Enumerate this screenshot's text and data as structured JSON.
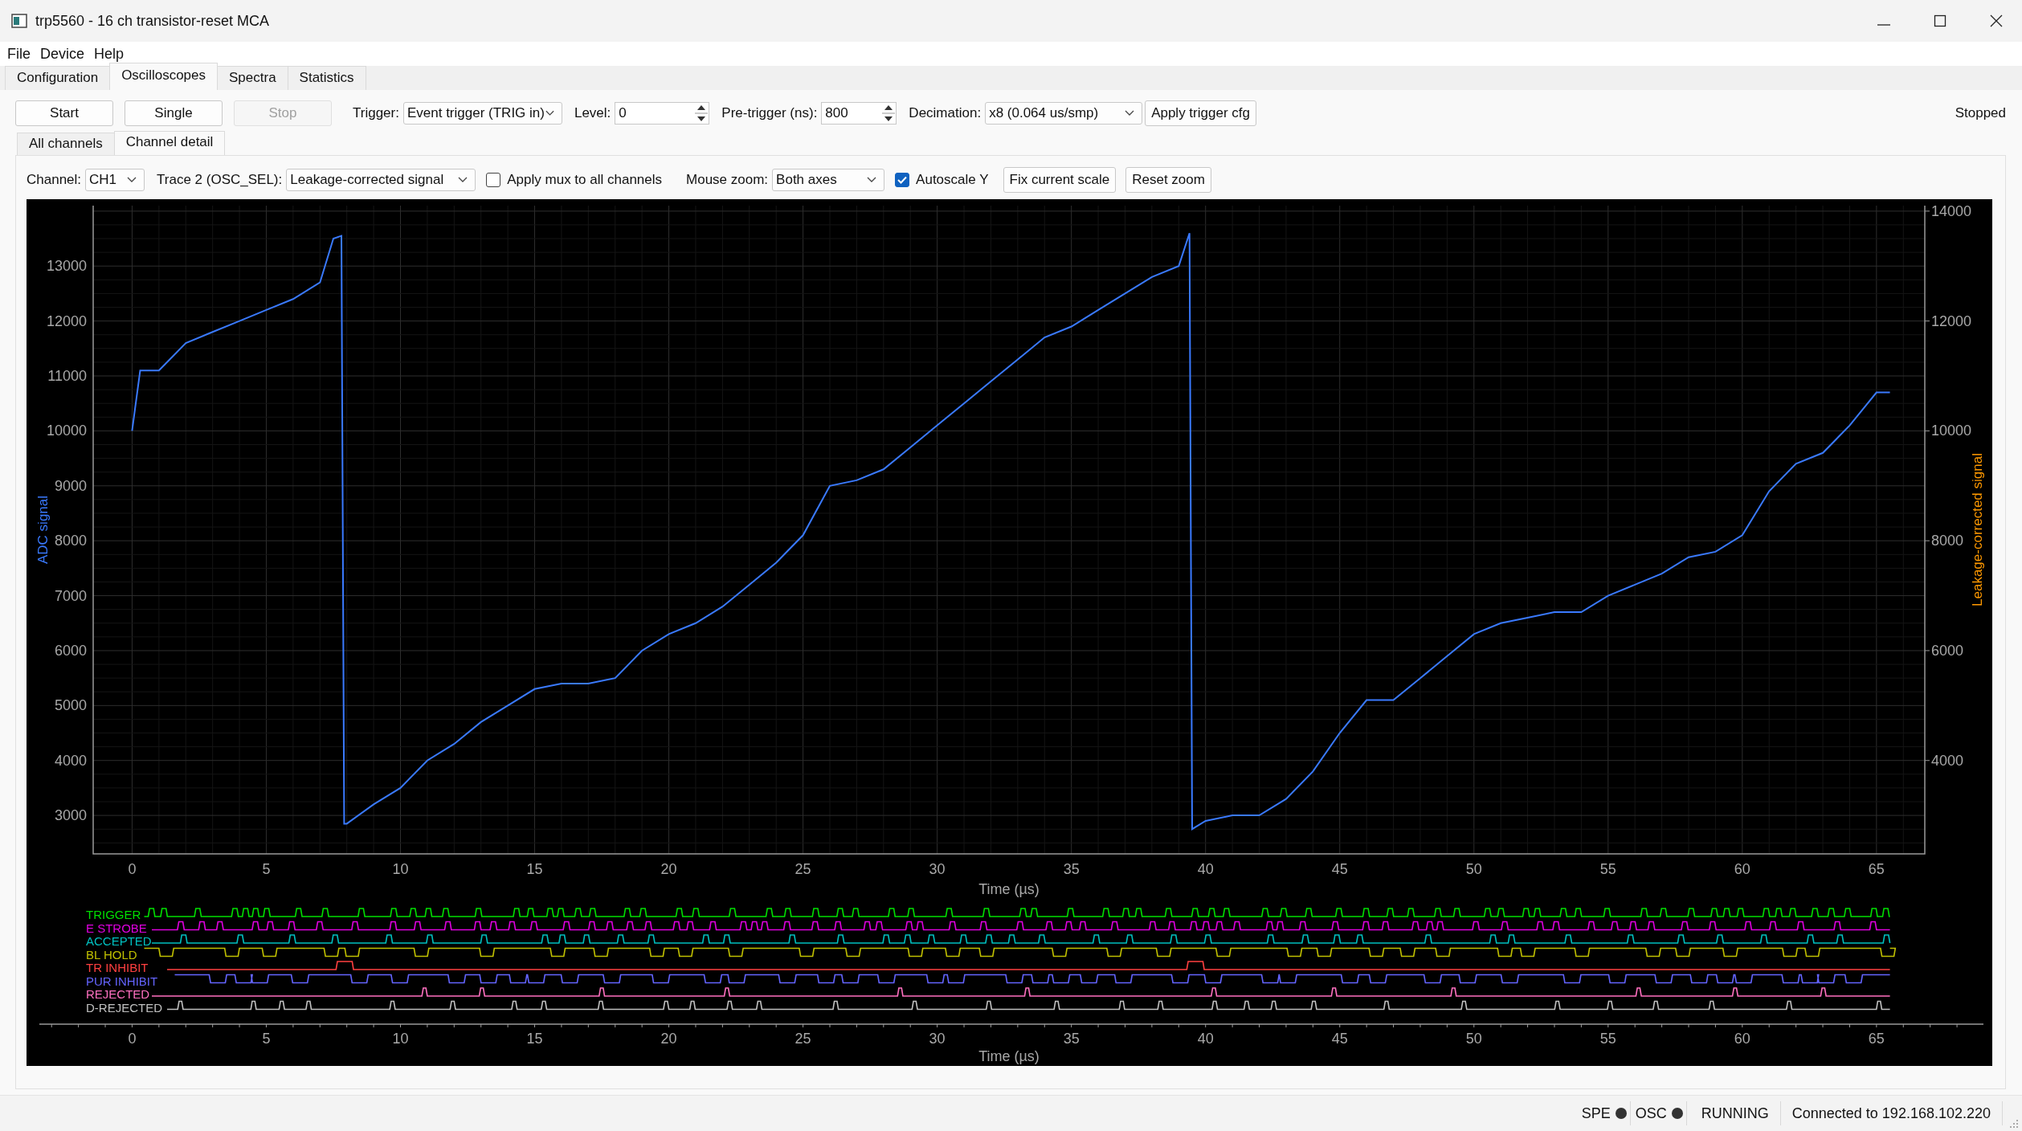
{
  "window": {
    "title": "trp5560 - 16 ch transistor-reset MCA"
  },
  "menu": [
    "File",
    "Device",
    "Help"
  ],
  "tabs": [
    {
      "label": "Configuration",
      "selected": false
    },
    {
      "label": "Oscilloscopes",
      "selected": true
    },
    {
      "label": "Spectra",
      "selected": false
    },
    {
      "label": "Statistics",
      "selected": false
    }
  ],
  "toolbar": {
    "buttons": [
      {
        "label": "Start",
        "disabled": false
      },
      {
        "label": "Single",
        "disabled": false
      },
      {
        "label": "Stop",
        "disabled": true
      }
    ],
    "trigger": {
      "label": "Trigger:",
      "value": "Event trigger (TRIG in)"
    },
    "level": {
      "label": "Level:",
      "value": "0"
    },
    "pretrigger": {
      "label": "Pre-trigger (ns):",
      "value": "800"
    },
    "decimation": {
      "label": "Decimation:",
      "value": "x8 (0.064 us/smp)"
    },
    "apply_button": "Apply trigger cfg",
    "state": "Stopped"
  },
  "subtabs": [
    {
      "label": "All channels",
      "selected": false
    },
    {
      "label": "Channel detail",
      "selected": true
    }
  ],
  "controls": {
    "channel": {
      "label": "Channel:",
      "value": "CH1"
    },
    "trace2": {
      "label": "Trace 2 (OSC_SEL):",
      "value": "Leakage-corrected signal"
    },
    "mux": {
      "label": "Apply mux to all channels",
      "checked": false
    },
    "mouse_zoom": {
      "label": "Mouse zoom:",
      "value": "Both axes"
    },
    "autoscale": {
      "label": "Autoscale Y",
      "checked": true
    },
    "buttons": [
      "Fix current scale",
      "Reset zoom"
    ]
  },
  "plot": {
    "chart_data": {
      "type": "line",
      "grid": true,
      "xlabel": "Time (µs)",
      "x": [
        0,
        0.3,
        1,
        2,
        3,
        4,
        5,
        6,
        7,
        7.5,
        7.8,
        7.9,
        8,
        9,
        10,
        11,
        12,
        13,
        14,
        15,
        16,
        17,
        18,
        19,
        20,
        21,
        22,
        23,
        24,
        25,
        26,
        27,
        28,
        29,
        30,
        31,
        32,
        33,
        34,
        35,
        36,
        37,
        38,
        39,
        39.4,
        39.5,
        40,
        41,
        42,
        43,
        44,
        45,
        46,
        47,
        48,
        49,
        50,
        51,
        52,
        53,
        54,
        55,
        56,
        57,
        58,
        59,
        60,
        61,
        62,
        63,
        64,
        65,
        65.5
      ],
      "series": [
        {
          "name": "ADC signal",
          "color": "#3a7aff",
          "values": [
            10000,
            11100,
            11100,
            11600,
            11800,
            12000,
            12200,
            12400,
            12700,
            13500,
            13550,
            2850,
            2850,
            3200,
            3500,
            4000,
            4300,
            4700,
            5000,
            5300,
            5400,
            5400,
            5500,
            6000,
            6300,
            6500,
            6800,
            7200,
            7600,
            8100,
            9000,
            9100,
            9300,
            9700,
            10100,
            10500,
            10900,
            11300,
            11700,
            11900,
            12200,
            12500,
            12800,
            13000,
            13600,
            2750,
            2900,
            3000,
            3000,
            3300,
            3800,
            4500,
            5100,
            5100,
            5500,
            5900,
            6300,
            6500,
            6600,
            6700,
            6700,
            7000,
            7200,
            7400,
            7700,
            7800,
            8100,
            8900,
            9400,
            9600,
            10100,
            10700,
            10700
          ]
        }
      ],
      "xlim": [
        -1.45,
        66.8
      ],
      "ylim": [
        2300,
        14100
      ],
      "xticks": [
        0,
        5,
        10,
        15,
        20,
        25,
        30,
        35,
        40,
        45,
        50,
        55,
        60,
        65
      ],
      "yticks": [
        3000,
        4000,
        5000,
        6000,
        7000,
        8000,
        9000,
        10000,
        11000,
        12000,
        13000
      ]
    },
    "right_axis": {
      "label": "Leakage-corrected signal",
      "color": "#ff9900",
      "ticks": [
        "14000",
        "12000",
        "10000",
        "8000",
        "6000",
        "4000"
      ]
    },
    "logic": {
      "signals": [
        {
          "name": "TRIGGER",
          "color": "#00e000"
        },
        {
          "name": "E STROBE",
          "color": "#e000e0"
        },
        {
          "name": "ACCEPTED",
          "color": "#00c0c0"
        },
        {
          "name": "BL HOLD",
          "color": "#c0c000"
        },
        {
          "name": "TR INHIBIT",
          "color": "#ff4040"
        },
        {
          "name": "PUR INHIBIT",
          "color": "#6464ff"
        },
        {
          "name": "REJECTED",
          "color": "#ff70c0"
        },
        {
          "name": "D-REJECTED",
          "color": "#c0c0c0"
        }
      ],
      "xticks": [
        "0",
        "5",
        "10",
        "15",
        "20",
        "25",
        "30",
        "35",
        "40",
        "45",
        "50",
        "55",
        "60",
        "65"
      ],
      "xlabel": "Time (µs)"
    }
  },
  "status_bar": {
    "indicators": [
      {
        "label": "SPE",
        "color": "#333333"
      },
      {
        "label": "OSC",
        "color": "#333333"
      }
    ],
    "state": "RUNNING",
    "connection": "Connected to 192.168.102.220"
  }
}
